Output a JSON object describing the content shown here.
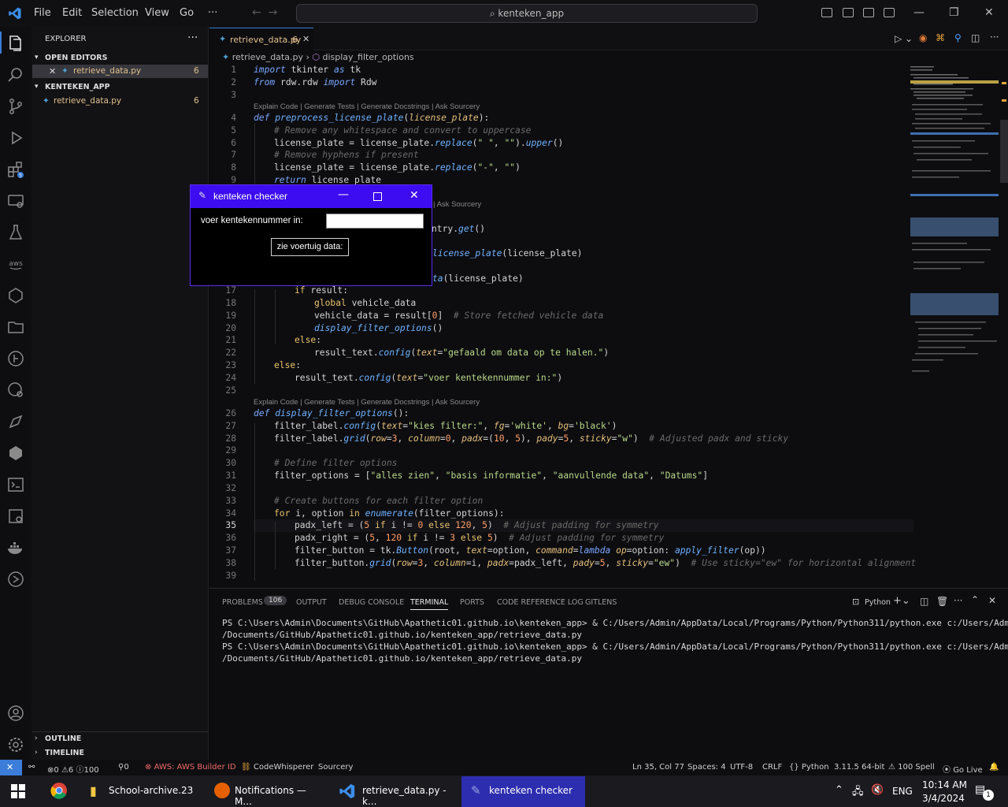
{
  "titlebar": {
    "menus": [
      "File",
      "Edit",
      "Selection",
      "View",
      "Go"
    ],
    "more": "···",
    "search": "kenteken_app"
  },
  "explorer": {
    "title": "EXPLORER",
    "open_editors_label": "OPEN EDITORS",
    "open_file": "retrieve_data.py",
    "open_file_badge": "6",
    "folder": "KENTEKEN_APP",
    "file": "retrieve_data.py",
    "file_badge": "6",
    "outline": "OUTLINE",
    "timeline": "TIMELINE"
  },
  "tab": {
    "label": "retrieve_data.py",
    "badge": "6"
  },
  "breadcrumb": {
    "file": "retrieve_data.py",
    "symbol": "display_filter_options"
  },
  "codelens": "Explain Code | Generate Tests | Generate Docstrings | Ask Sourcery",
  "code_lines": [
    "1",
    "2",
    "3",
    "4",
    "5",
    "6",
    "7",
    "8",
    "9",
    "17",
    "18",
    "19",
    "20",
    "21",
    "22",
    "23",
    "24",
    "25",
    "26",
    "27",
    "28",
    "29",
    "30",
    "31",
    "32",
    "33",
    "34",
    "35",
    "36",
    "37",
    "38",
    "39"
  ],
  "code": {
    "l1": [
      "import",
      " tkinter ",
      "as",
      " tk"
    ],
    "l2": [
      "from",
      " rdw.rdw ",
      "import",
      " Rdw"
    ],
    "l4": [
      "def ",
      "preprocess_license_plate",
      "(",
      "license_plate",
      "):"
    ],
    "l5": "# Remove any whitespace and convert to uppercase",
    "l6": [
      "license_plate = license_plate.",
      "replace",
      "(",
      "\" \"",
      ", ",
      "\"\"",
      ").",
      "upper",
      "()"
    ],
    "l7": "# Remove hyphens if present",
    "l8": [
      "license_plate = license_plate.",
      "replace",
      "(",
      "\"-\"",
      ", ",
      "\"\"",
      ")"
    ],
    "l9": [
      "return",
      " license_plate"
    ],
    "frag1": [
      "ntry.",
      "get",
      "()"
    ],
    "frag2": [
      "license_plate",
      "(license_plate)"
    ],
    "frag3": [
      "ta",
      "(license_plate)"
    ],
    "frag_lens": "Ask Sourcery",
    "l17": [
      "if",
      " result:"
    ],
    "l18": [
      "global",
      " vehicle_data"
    ],
    "l19": [
      "vehicle_data = result[",
      "0",
      "]  ",
      "# Store fetched vehicle data"
    ],
    "l20": [
      "display_filter_options",
      "()"
    ],
    "l21": [
      "else",
      ":"
    ],
    "l22": [
      "result_text.",
      "config",
      "(",
      "text",
      "=",
      "\"gefaald om data op te halen.\"",
      ")"
    ],
    "l23": [
      "else",
      ":"
    ],
    "l24": [
      "result_text.",
      "config",
      "(",
      "text",
      "=",
      "\"voer kentekennummer in:\"",
      ")"
    ],
    "l26": [
      "def ",
      "display_filter_options",
      "():"
    ],
    "l27": [
      "filter_label.",
      "config",
      "(",
      "text",
      "=",
      "\"kies filter:\"",
      ", ",
      "fg",
      "=",
      "'white'",
      ", ",
      "bg",
      "=",
      "'black'",
      ")"
    ],
    "l28": [
      "filter_label.",
      "grid",
      "(",
      "row",
      "=",
      "3",
      ", ",
      "column",
      "=",
      "0",
      ", ",
      "padx",
      "=(",
      "10",
      ", ",
      "5",
      "), ",
      "pady",
      "=",
      "5",
      ", ",
      "sticky",
      "=",
      "\"w\"",
      ")  ",
      "# Adjusted padx and sticky"
    ],
    "l30": "# Define filter options",
    "l31": [
      "filter_options = [",
      "\"alles zien\"",
      ", ",
      "\"basis informatie\"",
      ", ",
      "\"aanvullende data\"",
      ", ",
      "\"Datums\"",
      "]"
    ],
    "l33": "# Create buttons for each filter option",
    "l34": [
      "for",
      " i, option ",
      "in",
      " ",
      "enumerate",
      "(filter_options):"
    ],
    "l35": [
      "padx_left = (",
      "5",
      " ",
      "if",
      " i != ",
      "0",
      " ",
      "else",
      " ",
      "120",
      ", ",
      "5",
      ")  ",
      "# Adjust padding for symmetry"
    ],
    "l36": [
      "padx_right = (",
      "5",
      ", ",
      "120",
      " ",
      "if",
      " i != ",
      "3",
      " ",
      "else",
      " ",
      "5",
      ")  ",
      "# Adjust padding for symmetry"
    ],
    "l37": [
      "filter_button = tk.",
      "Button",
      "(root, ",
      "text",
      "=option, ",
      "command",
      "=",
      "lambda",
      " ",
      "op",
      "=option: ",
      "apply_filter",
      "(op))"
    ],
    "l38": [
      "filter_button.",
      "grid",
      "(",
      "row",
      "=",
      "3",
      ", ",
      "column",
      "=i, ",
      "padx",
      "=padx_left, ",
      "pady",
      "=",
      "5",
      ", ",
      "sticky",
      "=",
      "\"ew\"",
      ")  ",
      "# Use sticky=\"ew\" for horizontal alignment"
    ]
  },
  "panel": {
    "tabs": [
      "PROBLEMS",
      "OUTPUT",
      "DEBUG CONSOLE",
      "TERMINAL",
      "PORTS",
      "CODE REFERENCE LOG",
      "GITLENS"
    ],
    "problems_count": "106",
    "shell": "Python",
    "terminal": [
      "PS C:\\Users\\Admin\\Documents\\GitHub\\Apathetic01.github.io\\kenteken_app> & C:/Users/Admin/AppData/Local/Programs/Python/Python311/python.exe c:/Users/Admin",
      "/Documents/GitHub/Apathetic01.github.io/kenteken_app/retrieve_data.py",
      "PS C:\\Users\\Admin\\Documents\\GitHub\\Apathetic01.github.io\\kenteken_app> & C:/Users/Admin/AppData/Local/Programs/Python/Python311/python.exe c:/Users/Admin",
      "/Documents/GitHub/Apathetic01.github.io/kenteken_app/retrieve_data.py"
    ]
  },
  "statusbar": {
    "errors": "0",
    "warnings": "6",
    "infos": "100",
    "ports": "0",
    "aws": "AWS: AWS Builder ID",
    "codewhisperer": "CodeWhisperer",
    "sourcery": "Sourcery",
    "position": "Ln 35, Col 77",
    "spaces": "Spaces: 4",
    "encoding": "UTF-8",
    "eol": "CRLF",
    "language": "Python",
    "interpreter": "3.11.5 64-bit",
    "spell": "100 Spell",
    "golive": "Go Live"
  },
  "tk": {
    "title": "kenteken checker",
    "label": "voer kentekennummer in:",
    "button": "zie voertuig data:",
    "entry_value": ""
  },
  "taskbar": {
    "items": [
      "School-archive.23",
      "Notifications — M...",
      "retrieve_data.py - k...",
      "kenteken checker"
    ],
    "lang": "ENG",
    "time": "10:14 AM",
    "date": "3/4/2024",
    "notif_count": "1"
  },
  "colors": {
    "accent": "#3b7dd8",
    "tk_title": "#3d0cf0",
    "statusbar": "#0e0e11"
  }
}
